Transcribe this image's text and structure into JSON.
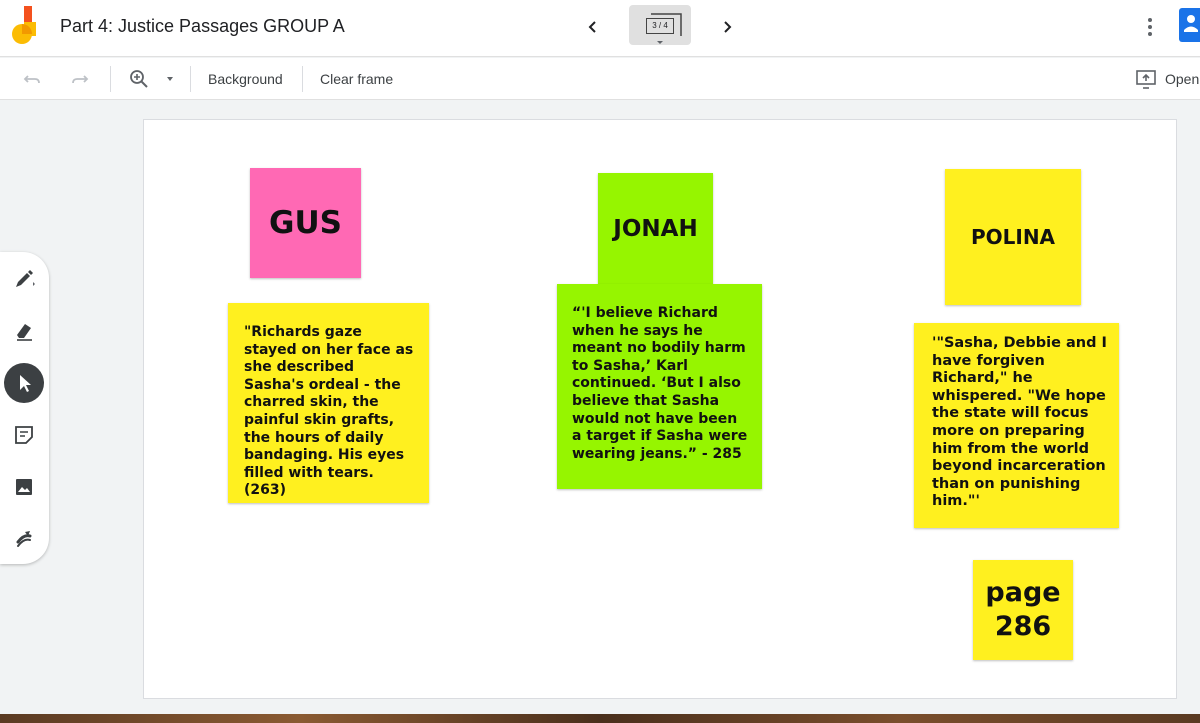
{
  "header": {
    "title": "Part 4: Justice Passages GROUP A",
    "frame_indicator": "3 / 4"
  },
  "toolbar": {
    "background_label": "Background",
    "clear_frame_label": "Clear frame",
    "open_label": "Open"
  },
  "tools": [
    "pen",
    "eraser",
    "select",
    "sticky-note",
    "image",
    "laser"
  ],
  "notes": {
    "gus": "GUS",
    "gus_quote": "\"Richards gaze stayed on her face as she described Sasha's ordeal - the charred skin, the painful skin grafts, the hours of daily bandaging. His eyes filled with tears. (263)",
    "jonah": "JONAH",
    "jonah_quote": "“'I believe Richard when he says he meant no bodily harm to Sasha,’ Karl continued. ‘But I also believe that Sasha would not have been a target if Sasha were wearing jeans.” - 285",
    "polina": "POLINA",
    "polina_quote": "'\"Sasha, Debbie and I have forgiven Richard,\" he whispered. \"We hope the state will focus more on preparing him from the world beyond incarceration than on punishing him.\"'",
    "page_label": "page 286"
  },
  "colors": {
    "pink": "#ff69b4",
    "yellow": "#fff01f",
    "green": "#96f500",
    "accent": "#1a73e8"
  }
}
